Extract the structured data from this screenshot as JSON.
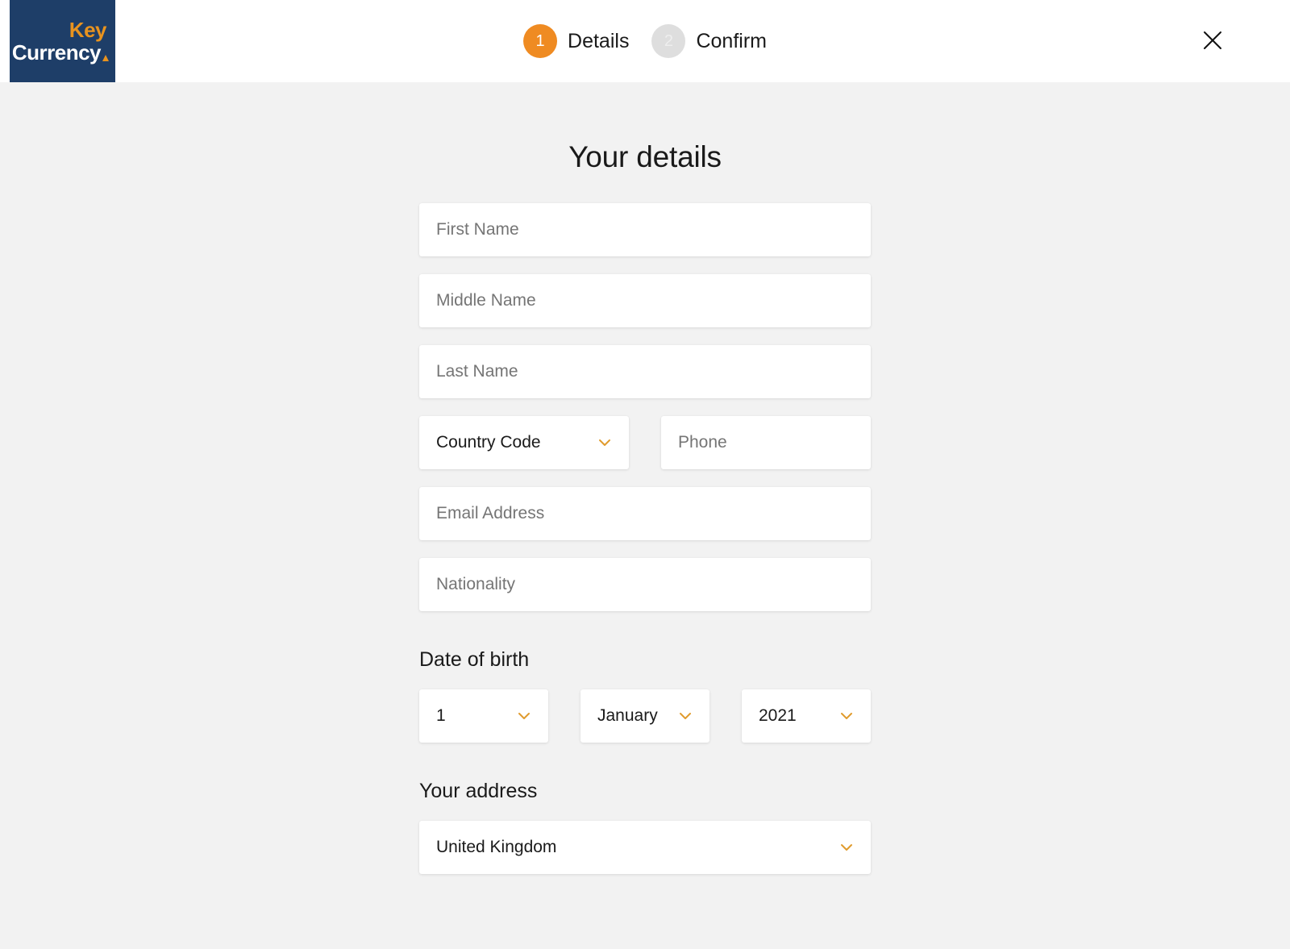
{
  "brand": {
    "logo_line1": "Key",
    "logo_line2": "Currency",
    "navy": "#1e3e68",
    "orange": "#e8931f"
  },
  "header": {
    "close_icon": "close-icon",
    "steps": [
      {
        "number": "1",
        "label": "Details",
        "state": "active"
      },
      {
        "number": "2",
        "label": "Confirm",
        "state": "inactive"
      }
    ]
  },
  "main": {
    "title": "Your details",
    "fields": {
      "first_name_placeholder": "First Name",
      "middle_name_placeholder": "Middle Name",
      "last_name_placeholder": "Last Name",
      "country_code_value": "Country Code",
      "phone_placeholder": "Phone",
      "email_placeholder": "Email Address",
      "nationality_placeholder": "Nationality"
    },
    "date_of_birth": {
      "heading": "Date of birth",
      "day": "1",
      "month": "January",
      "year": "2021"
    },
    "address": {
      "heading": "Your address",
      "country": "United Kingdom"
    }
  }
}
